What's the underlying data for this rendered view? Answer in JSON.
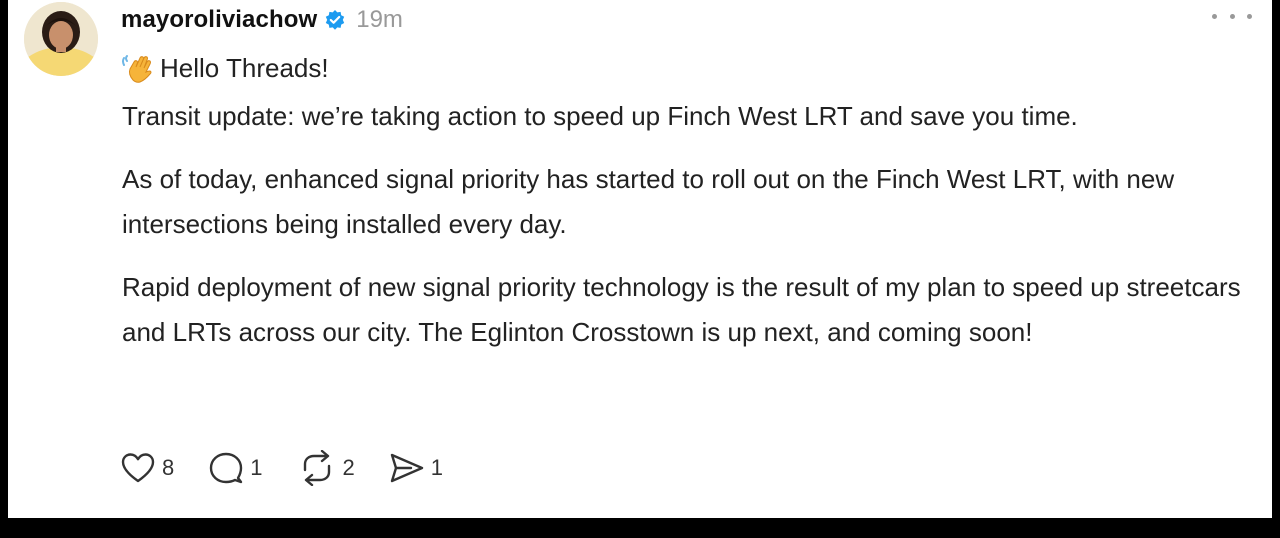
{
  "post": {
    "username": "mayoroliviachow",
    "time": "19m",
    "greeting": "Hello Threads!",
    "paragraphs": [
      "Transit update: we’re taking action to speed up Finch West LRT and save you time.",
      "As of today, enhanced signal priority has started to roll out on the Finch West LRT, with new intersections being installed every day.",
      "Rapid deployment of new signal priority technology is the result of my plan to speed up streetcars and LRTs across our city. The Eglinton Crosstown is up next, and coming soon!"
    ]
  },
  "actions": {
    "likes": "8",
    "replies": "1",
    "reposts": "2",
    "shares": "1"
  },
  "icons": {
    "verified": "verified-badge-icon",
    "wave": "waving-hand-icon",
    "like": "heart-icon",
    "reply": "comment-bubble-icon",
    "repost": "repost-arrows-icon",
    "share": "send-icon",
    "more": "more-options-icon"
  },
  "colors": {
    "verified": "#1d9bf0",
    "muted": "#999999"
  }
}
